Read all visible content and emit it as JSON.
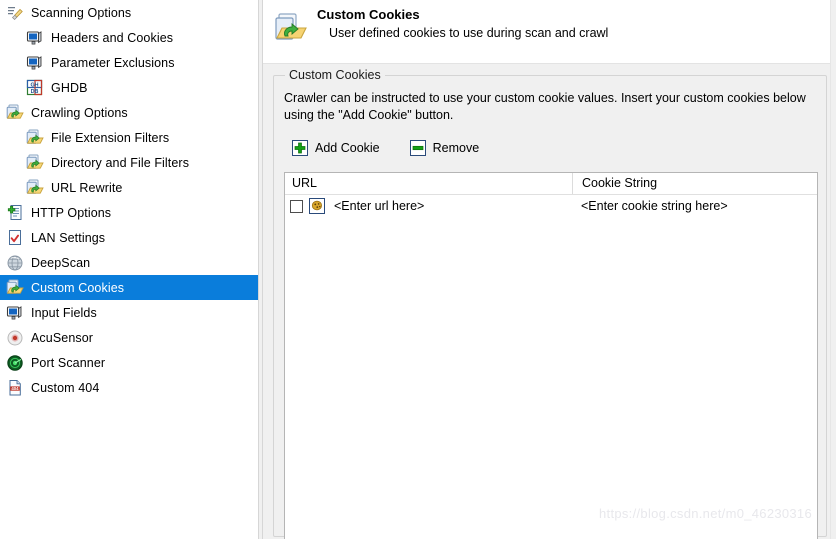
{
  "sidebar": {
    "items": [
      {
        "label": "Scanning Options",
        "icon": "scan-brush-icon",
        "level": 0,
        "selected": false
      },
      {
        "label": "Headers and Cookies",
        "icon": "monitor-icon",
        "level": 1,
        "selected": false
      },
      {
        "label": "Parameter Exclusions",
        "icon": "monitor-icon",
        "level": 1,
        "selected": false
      },
      {
        "label": "GHDB",
        "icon": "ghdb-grid-icon",
        "level": 1,
        "selected": false
      },
      {
        "label": "Crawling Options",
        "icon": "folder-arrow-icon",
        "level": 0,
        "selected": false
      },
      {
        "label": "File Extension Filters",
        "icon": "folder-arrow-icon",
        "level": 1,
        "selected": false
      },
      {
        "label": "Directory and File Filters",
        "icon": "folder-arrow-icon",
        "level": 1,
        "selected": false
      },
      {
        "label": "URL Rewrite",
        "icon": "folder-arrow-icon",
        "level": 1,
        "selected": false
      },
      {
        "label": "HTTP Options",
        "icon": "document-plus-icon",
        "level": 0,
        "selected": false
      },
      {
        "label": "LAN Settings",
        "icon": "document-check-icon",
        "level": 0,
        "selected": false
      },
      {
        "label": "DeepScan",
        "icon": "globe-icon",
        "level": 0,
        "selected": false
      },
      {
        "label": "Custom Cookies",
        "icon": "folder-arrow-icon",
        "level": 0,
        "selected": true
      },
      {
        "label": "Input Fields",
        "icon": "monitor-icon",
        "level": 0,
        "selected": false
      },
      {
        "label": "AcuSensor",
        "icon": "sensor-dot-icon",
        "level": 0,
        "selected": false
      },
      {
        "label": "Port Scanner",
        "icon": "radar-icon",
        "level": 0,
        "selected": false
      },
      {
        "label": "Custom 404",
        "icon": "document-404-icon",
        "level": 0,
        "selected": false
      }
    ]
  },
  "header": {
    "icon": "folder-arrow-icon",
    "title": "Custom Cookies",
    "subtitle": "User defined cookies to use during scan and crawl"
  },
  "groupbox": {
    "title": "Custom Cookies",
    "description": "Crawler can be instructed to use your custom cookie values. Insert your custom cookies below using the \"Add Cookie\" button."
  },
  "toolbar": {
    "add_label": "Add Cookie",
    "add_icon": "green-plus-icon",
    "remove_label": "Remove",
    "remove_icon": "green-minus-icon"
  },
  "table": {
    "columns": [
      "URL",
      "Cookie String"
    ],
    "rows": [
      {
        "checked": false,
        "icon": "cookie-icon",
        "url": "<Enter url here>",
        "cookie_string": "<Enter cookie string here>"
      }
    ]
  },
  "watermark": {
    "text": "https://blog.csdn.net/m0_46230316"
  },
  "colors": {
    "selection": "#0a7ddb",
    "panel_background": "#f0f0f0",
    "content_background": "#ffffff",
    "accent_green": "#1a9a1a",
    "border": "#b5b5b5"
  }
}
